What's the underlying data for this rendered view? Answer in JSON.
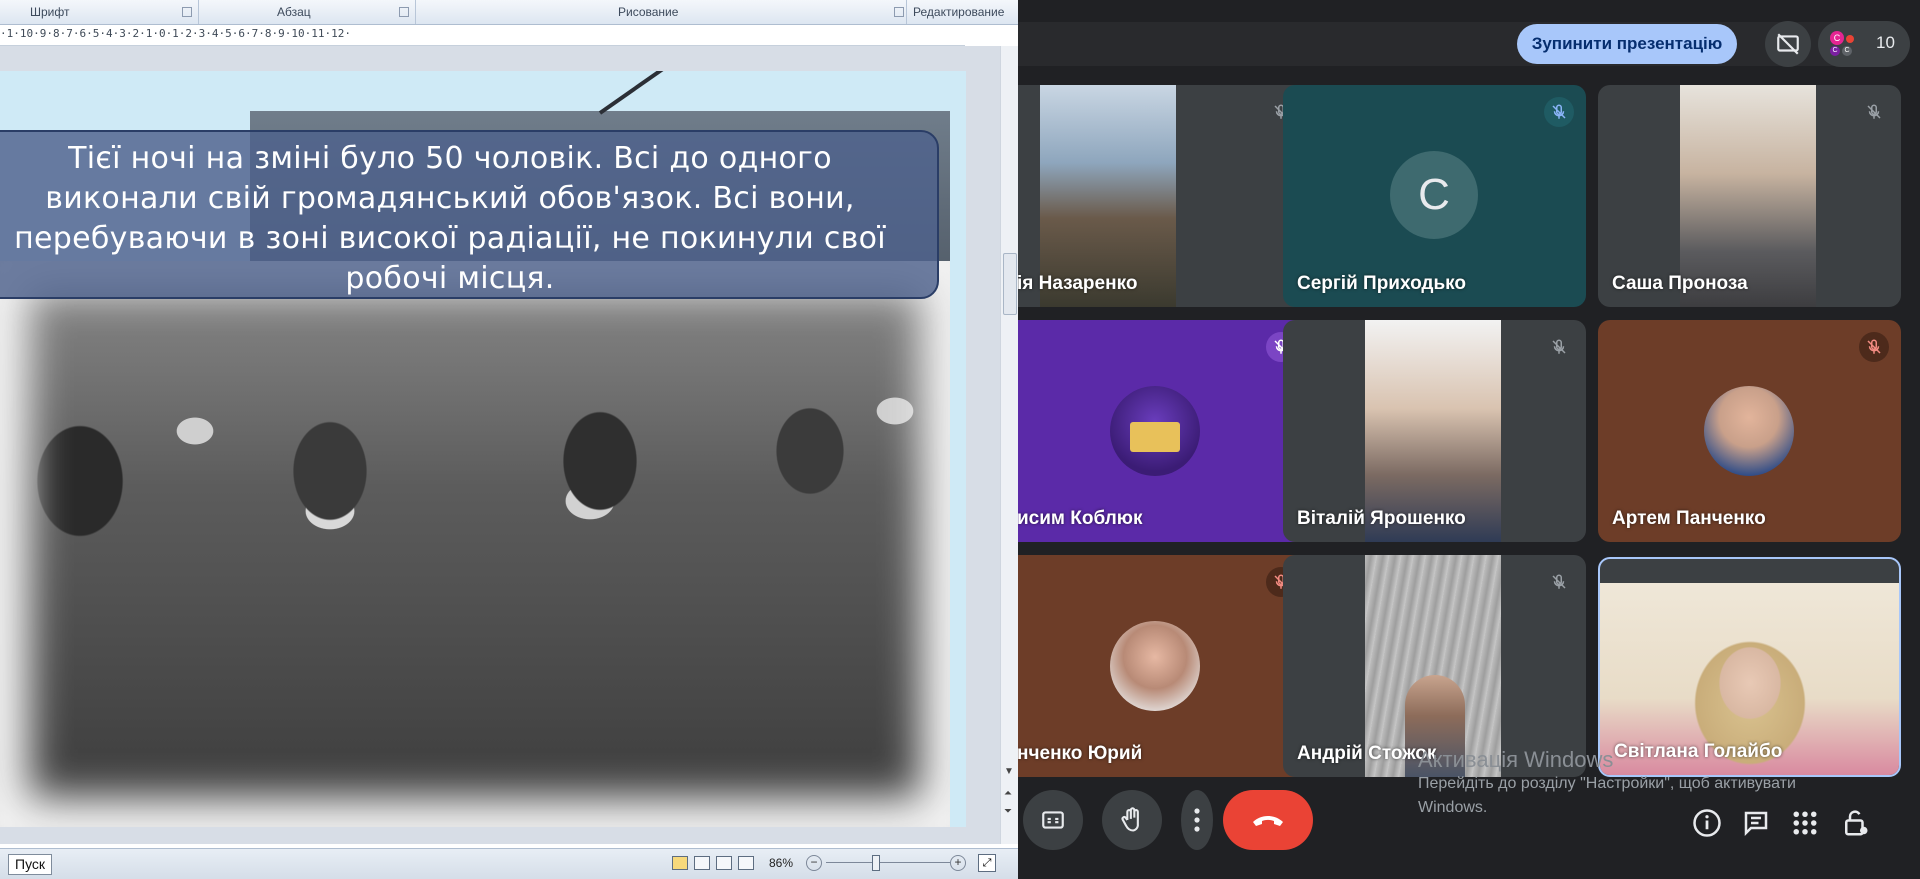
{
  "powerpoint": {
    "ribbon_groups": [
      "Шрифт",
      "Абзац",
      "Рисование",
      "Редактирование"
    ],
    "ruler_text": "·1·10·9·8·7·6·5·4·3·2·1·0·1·2·3·4·5·6·7·8·9·10·11·12·",
    "slide_caption": "Тієї ночі на зміні було 50 чоловік. Всі до одного виконали свій громадянський обов'язок. Всі вони, перебуваючи в зоні високої радіації, не покинули свої робочі місця.",
    "status": {
      "start_button": "Пуск",
      "zoom_level": "86%",
      "zoom_minus": "−",
      "zoom_plus": "+"
    }
  },
  "meet": {
    "stop_presentation": "Зупинити презентацію",
    "people_count": "10",
    "people_avatars": [
      "С",
      "С",
      "С"
    ],
    "participants": [
      {
        "name": "ія Назаренко",
        "mic_muted": true,
        "tile_color": "#3c4043"
      },
      {
        "name": "Сергій Приходько",
        "mic_muted": true,
        "tile_color": "#1b4b52",
        "initial": "С"
      },
      {
        "name": "Саша Проноза",
        "mic_muted": true,
        "tile_color": "#3c4043"
      },
      {
        "name": "исим Коблюк",
        "mic_muted": true,
        "tile_color": "#5b2aa8"
      },
      {
        "name": "Віталій Ярошенко",
        "mic_muted": true,
        "tile_color": "#3c4043"
      },
      {
        "name": "Артем Панченко",
        "mic_muted": true,
        "tile_color": "#6d3d28"
      },
      {
        "name": "нченко Юрий",
        "mic_muted": true,
        "tile_color": "#6d3d28"
      },
      {
        "name": "Андрій Стожок",
        "mic_muted": true,
        "tile_color": "#3c4043"
      },
      {
        "name": "Світлана Голайбо",
        "mic_muted": false,
        "tile_color": "#3c4043"
      }
    ],
    "windows_activation": {
      "title": "Активація Windows",
      "line1": "Перейдіть до розділу \"Настройки\", щоб активувати",
      "line2": "Windows."
    }
  },
  "colors": {
    "accent_blue": "#a8c7fa",
    "end_call_red": "#ea4335",
    "meet_bg": "#202124",
    "tile_dark": "#3c4043"
  },
  "icons": [
    "mic-off-icon",
    "present-off-icon",
    "captions-icon",
    "raise-hand-icon",
    "more-options-icon",
    "end-call-icon",
    "info-icon",
    "chat-icon",
    "activities-icon",
    "host-controls-icon"
  ]
}
